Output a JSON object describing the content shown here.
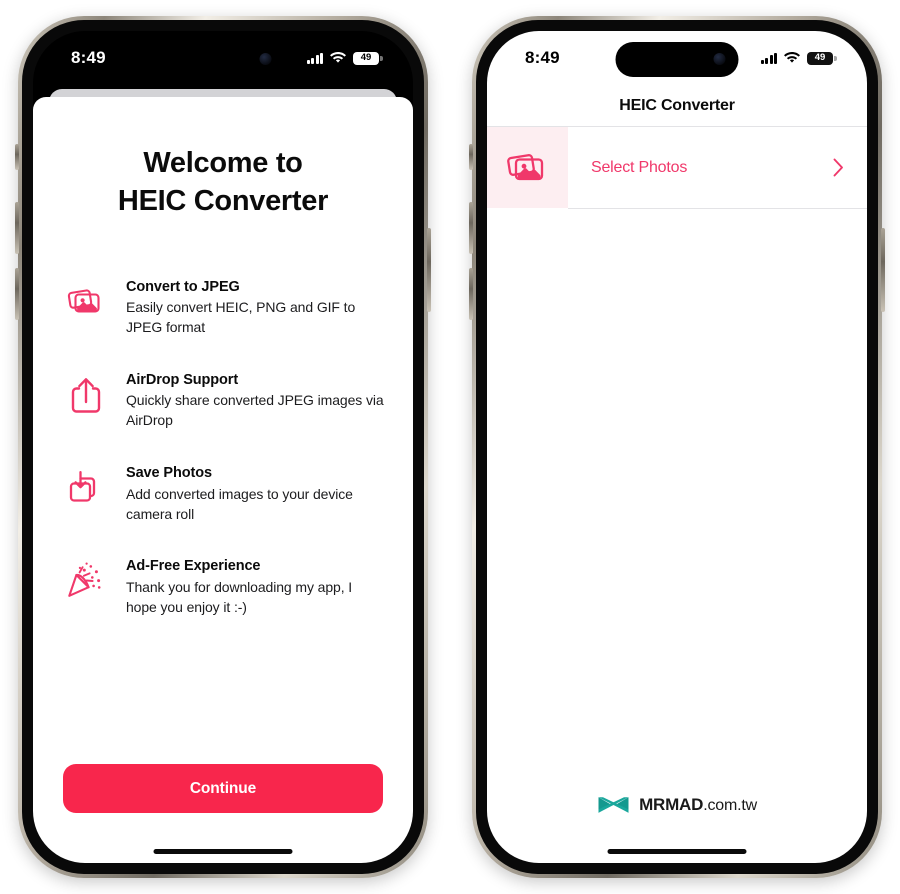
{
  "phones": {
    "left": {
      "status_bar": {
        "time": "8:49",
        "signal_icon": "cellular-bars-icon",
        "wifi_icon": "wifi-icon",
        "battery_level": "49",
        "battery_icon": "battery-icon"
      },
      "sheet": {
        "welcome_line1": "Welcome to",
        "welcome_line2": "HEIC Converter",
        "features": [
          {
            "icon": "photo-stack-icon",
            "title": "Convert to JPEG",
            "description": "Easily convert HEIC, PNG and GIF to JPEG format"
          },
          {
            "icon": "share-upload-icon",
            "title": "AirDrop Support",
            "description": "Quickly share converted JPEG images via AirDrop"
          },
          {
            "icon": "save-download-icon",
            "title": "Save Photos",
            "description": "Add converted images to your device camera roll"
          },
          {
            "icon": "party-popper-icon",
            "title": "Ad-Free Experience",
            "description": "Thank you for downloading my app, I hope you enjoy it :-)"
          }
        ],
        "continue_label": "Continue"
      }
    },
    "right": {
      "status_bar": {
        "time": "8:49",
        "signal_icon": "cellular-bars-icon",
        "wifi_icon": "wifi-icon",
        "battery_level": "49",
        "battery_icon": "battery-icon"
      },
      "nav_title": "HEIC Converter",
      "list": [
        {
          "icon": "photo-stack-icon",
          "label": "Select Photos",
          "accessory_icon": "chevron-right-icon"
        }
      ],
      "watermark": {
        "logo_icon": "mrmad-bowtie-logo-icon",
        "brand": "MRMAD",
        "domain": ".com.tw"
      }
    }
  },
  "colors": {
    "accent": "#f8264c",
    "accent_link": "#f0386a",
    "thumb_bg": "#fdeef1",
    "watermark_logo": "#16998e"
  }
}
